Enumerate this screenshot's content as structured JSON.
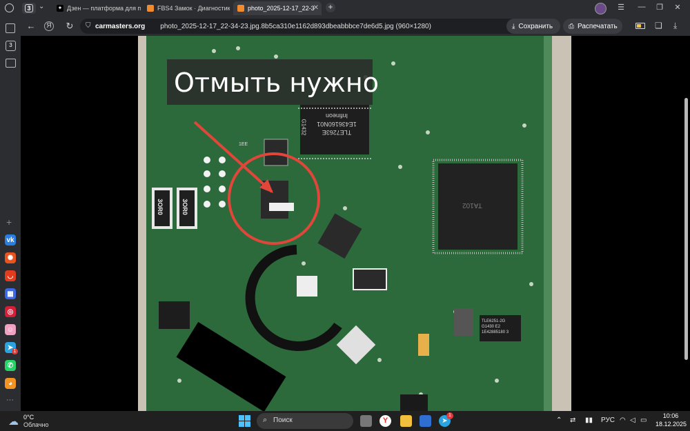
{
  "browser": {
    "tab_counter": "3",
    "tabs": [
      {
        "title": "Дзен — платформа для п",
        "active": false,
        "color": "#555555"
      },
      {
        "title": "FBS4 Замок · Диагностик",
        "active": false,
        "color": "#f28b2c"
      },
      {
        "title": "photo_2025-12-17_22-3",
        "active": true,
        "color": "#f28b2c"
      }
    ],
    "address": {
      "site": "carmasters.org",
      "path": "photo_2025-12-17_22-34-23.jpg.8b5ca310e1162d893dbeabbbce7de6d5.jpg (960×1280)"
    },
    "actions": {
      "save_label": "Сохранить",
      "print_label": "Распечатать"
    }
  },
  "sidebar": {
    "tab_badge": "3",
    "apps": [
      {
        "name": "vk-icon",
        "color": "#2a7de1",
        "glyph": "vk"
      },
      {
        "name": "app-orange-icon",
        "color": "#e8531f",
        "glyph": "✺"
      },
      {
        "name": "aliexpress-icon",
        "color": "#e23b1e",
        "glyph": "◡"
      },
      {
        "name": "apps-grid-icon",
        "color": "#3b6ae6",
        "glyph": "▦"
      },
      {
        "name": "app-red-icon",
        "color": "#d6203a",
        "glyph": "◎"
      },
      {
        "name": "app-pink-icon",
        "color": "#f0a2c0",
        "glyph": "☺"
      },
      {
        "name": "telegram-icon",
        "color": "#2aa3e0",
        "glyph": "➤",
        "badge": "1"
      },
      {
        "name": "whatsapp-icon",
        "color": "#25d366",
        "glyph": "✆"
      },
      {
        "name": "odnoklassniki-icon",
        "color": "#f29323",
        "glyph": "◕"
      }
    ],
    "more": "···"
  },
  "photo": {
    "caption": "Отмыть нужно",
    "chip_markings": {
      "main_chip_line1": "TLE7263E",
      "main_chip_line2": "1E436160N01",
      "main_chip_line3": "Infineon",
      "main_chip_side": "G1432",
      "resistor_1": "3OR0",
      "resistor_2": "3OR0",
      "small_chip_1": "1EE",
      "driver_chip_line1": "TLE6251-2G",
      "driver_chip_line2": "G1430 E2",
      "driver_chip_line3": "1E42885180 3",
      "mcu": "TA102"
    }
  },
  "taskbar": {
    "weather_temp": "0°C",
    "weather_desc": "Облачно",
    "search_placeholder": "Поиск",
    "language": "РУС",
    "time": "10:06",
    "date": "18.12.2025",
    "telegram_badge": "1"
  }
}
